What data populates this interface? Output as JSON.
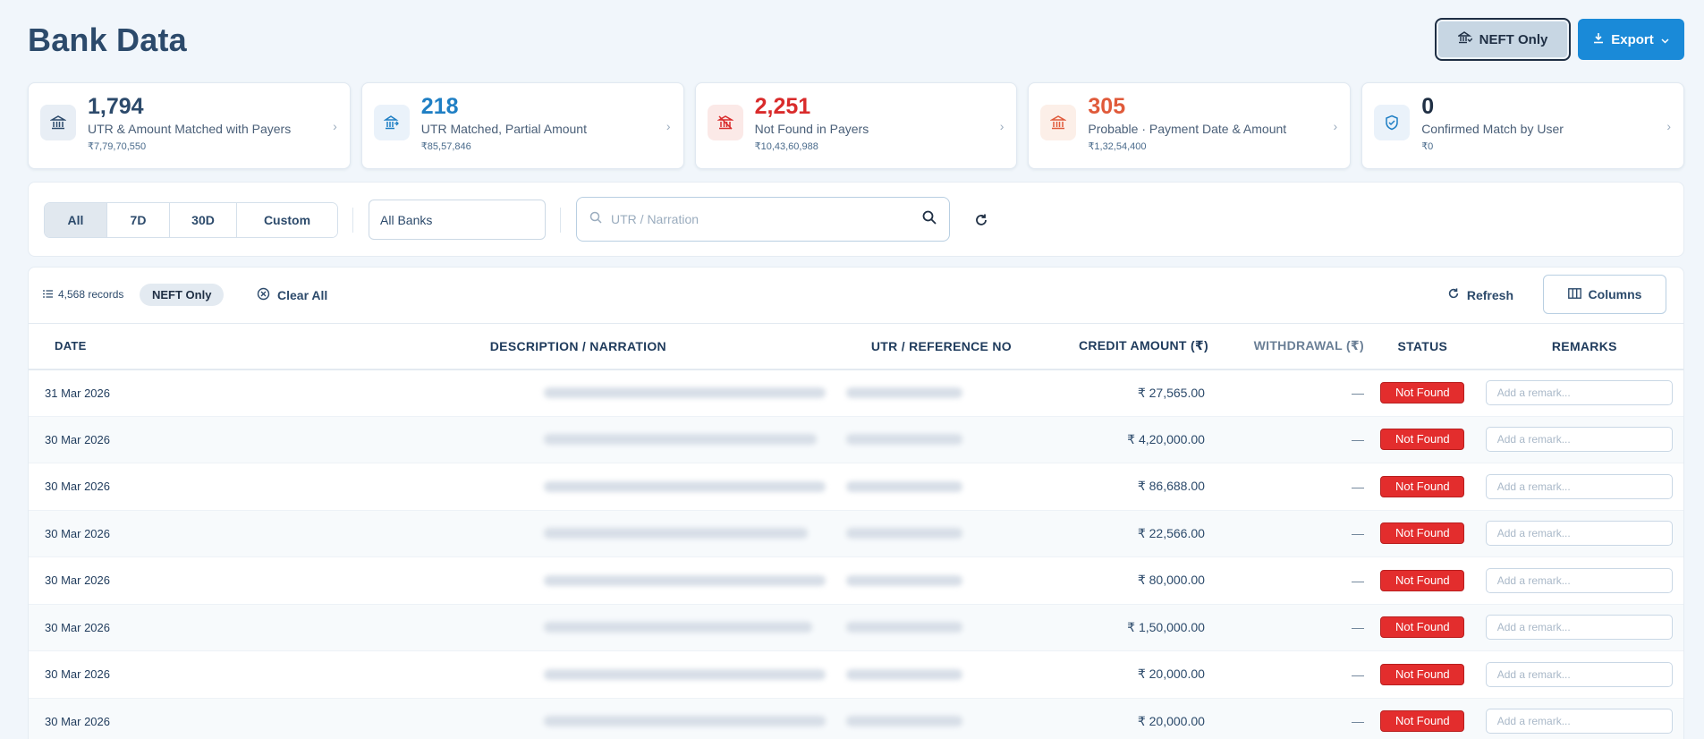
{
  "header": {
    "title": "Bank Data",
    "neft_label": "NEFT Only",
    "export_label": "Export"
  },
  "stats": [
    {
      "value": "1,794",
      "label": "UTR & Amount Matched with Payers",
      "amount": "₹7,79,70,550",
      "color": "#2c4a6b",
      "icon": "bank-icon"
    },
    {
      "value": "218",
      "label": "UTR Matched, Partial Amount",
      "amount": "₹85,57,846",
      "color": "#1f7fc4",
      "icon": "bank-partial-icon"
    },
    {
      "value": "2,251",
      "label": "Not Found in Payers",
      "amount": "₹10,43,60,988",
      "color": "#d92b2b",
      "icon": "bank-off-icon"
    },
    {
      "value": "305",
      "label": "Probable · Payment Date & Amount",
      "amount": "₹1,32,54,400",
      "color": "#e05a3a",
      "icon": "bank-probable-icon"
    },
    {
      "value": "0",
      "label": "Confirmed Match by User",
      "amount": "₹0",
      "color": "#1f2f44",
      "icon": "shield-check-icon"
    }
  ],
  "filters": {
    "ranges": [
      {
        "label": "All",
        "active": true
      },
      {
        "label": "7D",
        "active": false
      },
      {
        "label": "30D",
        "active": false
      },
      {
        "label": "Custom",
        "active": false
      }
    ],
    "bank_select": "All Banks",
    "search_placeholder": "UTR / Narration"
  },
  "toolbar": {
    "records": "4,568 records",
    "chip": "NEFT Only",
    "clear_all": "Clear All",
    "refresh": "Refresh",
    "columns": "Columns"
  },
  "table": {
    "headers": [
      "DATE",
      "DESCRIPTION / NARRATION",
      "UTR / REFERENCE NO",
      "CREDIT AMOUNT (₹)",
      "WITHDRAWAL (₹)",
      "STATUS",
      "REMARKS"
    ],
    "remark_placeholder": "Add a remark...",
    "rows": [
      {
        "date": "31 Mar 2026",
        "credit": "₹ 27,565.00",
        "withdrawal": "—",
        "status": "Not Found"
      },
      {
        "date": "30 Mar 2026",
        "credit": "₹ 4,20,000.00",
        "withdrawal": "—",
        "status": "Not Found"
      },
      {
        "date": "30 Mar 2026",
        "credit": "₹ 86,688.00",
        "withdrawal": "—",
        "status": "Not Found"
      },
      {
        "date": "30 Mar 2026",
        "credit": "₹ 22,566.00",
        "withdrawal": "—",
        "status": "Not Found"
      },
      {
        "date": "30 Mar 2026",
        "credit": "₹ 80,000.00",
        "withdrawal": "—",
        "status": "Not Found"
      },
      {
        "date": "30 Mar 2026",
        "credit": "₹ 1,50,000.00",
        "withdrawal": "—",
        "status": "Not Found"
      },
      {
        "date": "30 Mar 2026",
        "credit": "₹ 20,000.00",
        "withdrawal": "—",
        "status": "Not Found"
      },
      {
        "date": "30 Mar 2026",
        "credit": "₹ 20,000.00",
        "withdrawal": "—",
        "status": "Not Found"
      }
    ]
  }
}
